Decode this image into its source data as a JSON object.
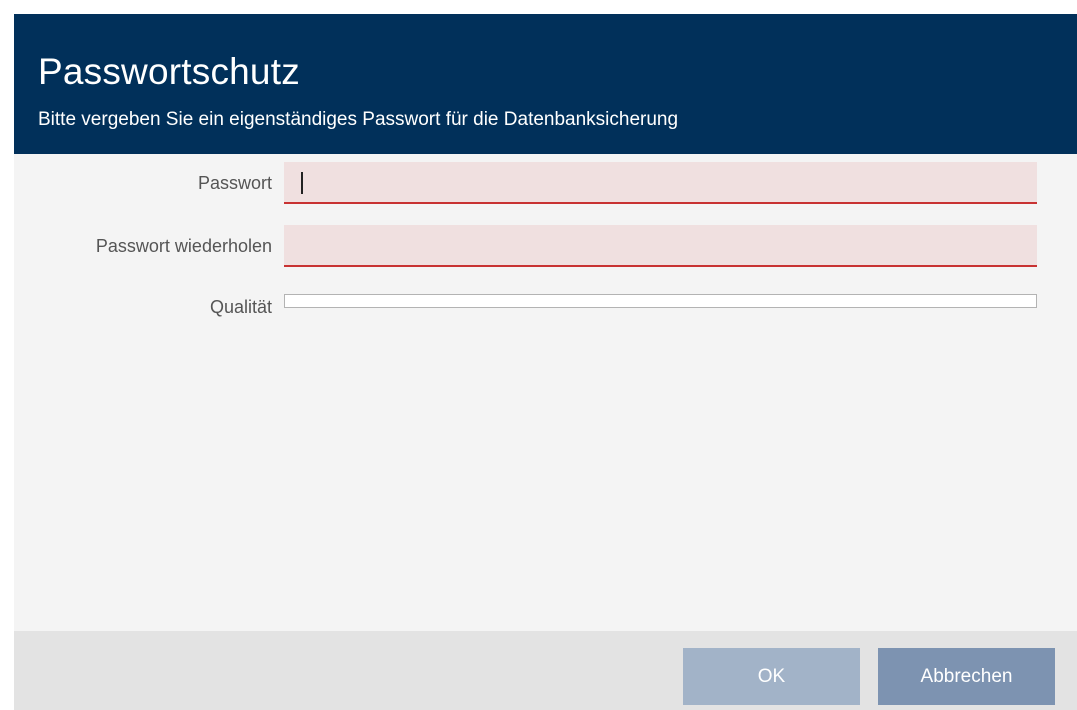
{
  "dialog": {
    "title": "Passwortschutz",
    "subtitle": "Bitte vergeben Sie ein eigenständiges Passwort für die Datenbanksicherung"
  },
  "form": {
    "password_label": "Passwort",
    "password_value": "",
    "password_repeat_label": "Passwort wiederholen",
    "password_repeat_value": "",
    "quality_label": "Qualität",
    "quality_level": 0
  },
  "buttons": {
    "ok_label": "OK",
    "ok_enabled": false,
    "cancel_label": "Abbrechen"
  },
  "colors": {
    "header_bg": "#01305a",
    "input_error_bg": "#f0e0e0",
    "input_error_underline": "#c83232",
    "button_disabled": "#a2b3c8",
    "button_primary": "#7d93b1"
  }
}
